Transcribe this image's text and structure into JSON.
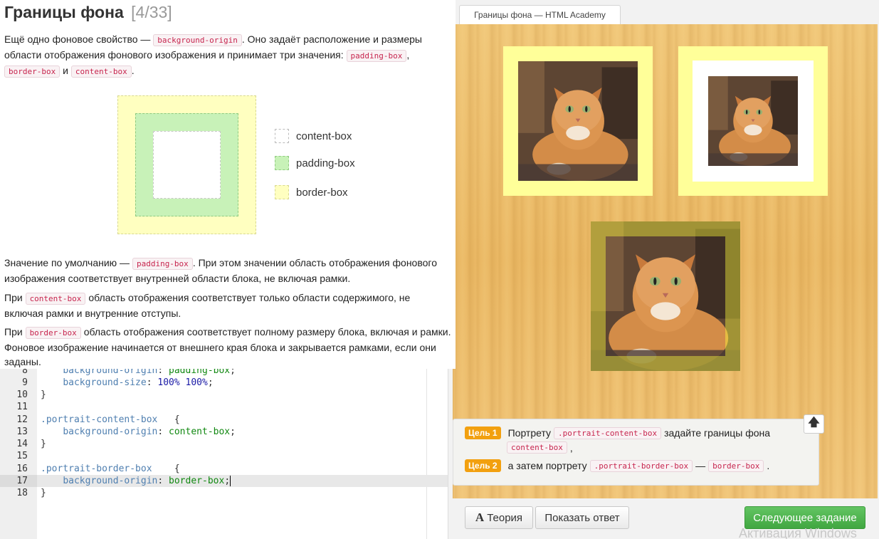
{
  "theory": {
    "title": "Границы фона",
    "counter": "[4/33]",
    "intro": {
      "t1": "Ещё одно фоновое свойство —",
      "c1": "background-origin",
      "t2": ". Оно задаёт расположение и размеры области отображения фонового изображения и принимает три значения:",
      "c2": "padding-box",
      "t3": ",",
      "c3": "border-box",
      "t4": "и",
      "c4": "content-box",
      "t5": "."
    },
    "legend": [
      "content-box",
      "padding-box",
      "border-box"
    ],
    "default": {
      "t1": "Значение по умолчанию —",
      "c1": "padding-box",
      "t2": ". При этом значении область отображения фонового изображения соответствует внутренней области блока, не включая рамки."
    },
    "content": {
      "t1": "При",
      "c1": "content-box",
      "t2": "область отображения соответствует только области содержимого, не включая рамки и внутренние отступы."
    },
    "border": {
      "t1": "При",
      "c1": "border-box",
      "t2": "область отображения соответствует полному размеру блока, включая и рамки. Фоновое изображение начинается от внешнего края блока и закрывается рамками, если они заданы."
    }
  },
  "editor": {
    "lines": [
      {
        "n": "8",
        "indent": "    ",
        "prop": "background-origin",
        "value": "padding-box",
        "end": ";"
      },
      {
        "n": "9",
        "indent": "    ",
        "prop": "background-size",
        "value": "100% 100%",
        "end": ";"
      },
      {
        "n": "10",
        "text": "}"
      },
      {
        "n": "11",
        "text": ""
      },
      {
        "n": "12",
        "selector": ".portrait-content-box",
        "text": "   {"
      },
      {
        "n": "13",
        "indent": "    ",
        "prop": "background-origin",
        "value": "content-box",
        "end": ";"
      },
      {
        "n": "14",
        "text": "}"
      },
      {
        "n": "15",
        "text": ""
      },
      {
        "n": "16",
        "selector": ".portrait-border-box",
        "text": "    {"
      },
      {
        "n": "17",
        "indent": "    ",
        "prop": "background-origin",
        "value": "border-box",
        "end": ";"
      },
      {
        "n": "18",
        "text": "}"
      }
    ],
    "active_line": "17"
  },
  "preview": {
    "tab_title": "Границы фона — HTML Academy",
    "colors": {
      "frame_yellow": "#ffff99",
      "wood": "#eebc6a"
    }
  },
  "goals": {
    "goal1": {
      "badge": "Цель 1",
      "t1": "Портрету",
      "c1": ".portrait-content-box",
      "t2": "задайте границы фона",
      "c2": "content-box",
      "t3": ","
    },
    "goal2": {
      "badge": "Цель 2",
      "t1": "а затем портрету",
      "c1": ".portrait-border-box",
      "t2": "—",
      "c2": "border-box",
      "t3": "."
    },
    "up_icon": "arrow-up-icon"
  },
  "buttons": {
    "theory": "Теория",
    "show_answer": "Показать ответ",
    "next": "Следующее задание"
  },
  "watermark": "Активация Windows"
}
